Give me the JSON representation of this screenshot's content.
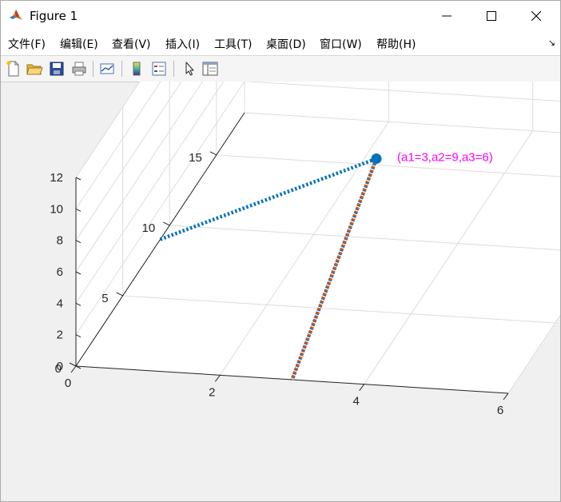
{
  "window": {
    "title": "Figure 1",
    "controls": {
      "minimize": "─",
      "maximize": "☐",
      "close": "✕"
    }
  },
  "menu": [
    "文件(F)",
    "编辑(E)",
    "查看(V)",
    "插入(I)",
    "工具(T)",
    "桌面(D)",
    "窗口(W)",
    "帮助(H)"
  ],
  "toolbar": {
    "tools": [
      "new-figure-icon",
      "open-file-icon",
      "save-icon",
      "print-icon",
      "link-plot-icon",
      "colorbar-icon",
      "legend-icon",
      "edit-plot-arrow-icon",
      "property-inspector-icon"
    ]
  },
  "colors": {
    "series1": "#0072bd",
    "series2": "#d95319",
    "annotation": "#ff00ff",
    "grid": "#dcdcdc",
    "axes_bg": "#ffffff"
  },
  "chart_data": {
    "type": "line",
    "view": "3d",
    "title": "",
    "x_ticks": [
      "0",
      "2",
      "4",
      "6"
    ],
    "y_ticks": [
      "0",
      "5",
      "10",
      "15"
    ],
    "z_ticks": [
      "0",
      "2",
      "4",
      "6",
      "8",
      "10",
      "12"
    ],
    "xlim": [
      0,
      6
    ],
    "ylim": [
      0,
      18
    ],
    "zlim": [
      0,
      12
    ],
    "grid": true,
    "series": [
      {
        "style": "dotted",
        "color": "#0072bd",
        "points": [
          [
            0,
            9,
            0
          ],
          [
            3,
            9,
            6
          ],
          [
            3,
            0,
            0
          ]
        ]
      },
      {
        "style": "dotted",
        "color": "#d95319",
        "points": [
          [
            3,
            9,
            6
          ],
          [
            3,
            0,
            0
          ]
        ]
      }
    ],
    "marker_point": [
      3,
      9,
      6
    ],
    "annotation": "(a1=3,a2=9,a3=6)"
  }
}
